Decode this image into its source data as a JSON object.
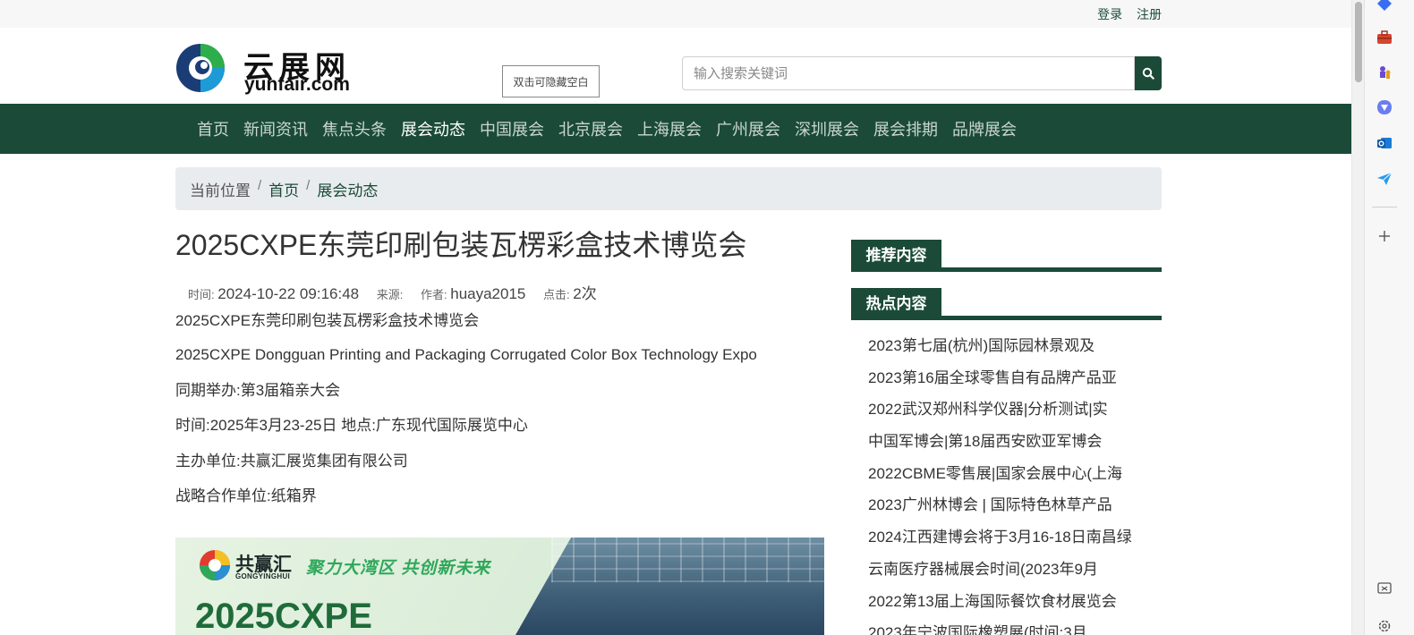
{
  "topbar": {
    "login": "登录",
    "register": "注册"
  },
  "logo": {
    "cn": "云展网",
    "en": "yunfair.com"
  },
  "hide_button": "双击可隐藏空白",
  "search": {
    "placeholder": "输入搜索关键词"
  },
  "nav": {
    "items": [
      "首页",
      "新闻资讯",
      "焦点头条",
      "展会动态",
      "中国展会",
      "北京展会",
      "上海展会",
      "广州展会",
      "深圳展会",
      "展会排期",
      "品牌展会"
    ],
    "active_index": 3
  },
  "breadcrumb": {
    "label": "当前位置",
    "sep": "/",
    "home": "首页",
    "current": "展会动态"
  },
  "article": {
    "title": "2025CXPE东莞印刷包装瓦楞彩盒技术博览会",
    "meta": {
      "time_label": "时间:",
      "time": "2024-10-22 09:16:48",
      "source_label": "来源:",
      "source": "",
      "author_label": "作者:",
      "author": "huaya2015",
      "clicks_label": "点击:",
      "clicks": "2次"
    },
    "paragraphs": [
      "2025CXPE东莞印刷包装瓦楞彩盒技术博览会",
      "2025CXPE Dongguan Printing and Packaging Corrugated Color Box Technology Expo",
      "同期举办:第3届箱亲大会",
      "时间:2025年3月23-25日 地点:广东现代国际展览中心",
      "主办单位:共赢汇展览集团有限公司",
      "战略合作单位:纸箱界"
    ],
    "banner": {
      "brand_cn": "共赢汇",
      "brand_en": "GONGYINGHUI",
      "slogan": "聚力大湾区 共创新未来",
      "headline": "2025CXPE"
    }
  },
  "sidebar": {
    "recommend_title": "推荐内容",
    "hot_title": "热点内容",
    "hot_items": [
      "2023第七届(杭州)国际园林景观及",
      "2023第16届全球零售自有品牌产品亚",
      "2022武汉郑州科学仪器|分析测试|实",
      "中国军博会|第18届西安欧亚军博会",
      "2022CBME零售展|国家会展中心(上海",
      "2023广州林博会 | 国际特色林草产品",
      "2024江西建博会将于3月16-18日南昌绿",
      "云南医疗器械展会时间(2023年9月",
      "2022第13届上海国际餐饮食材展览会",
      "2023年宁波国际橡塑展(时间:3月"
    ]
  },
  "colors": {
    "brand_green": "#1b4b38",
    "nav_text": "#c9d6cf",
    "crumb_bg": "#e9ecef"
  },
  "rail_icons": [
    "diamond-icon",
    "toolbox-icon",
    "chess-icon",
    "copilot-icon",
    "outlook-icon",
    "send-icon",
    "add-icon",
    "screenshot-icon",
    "settings-icon"
  ]
}
